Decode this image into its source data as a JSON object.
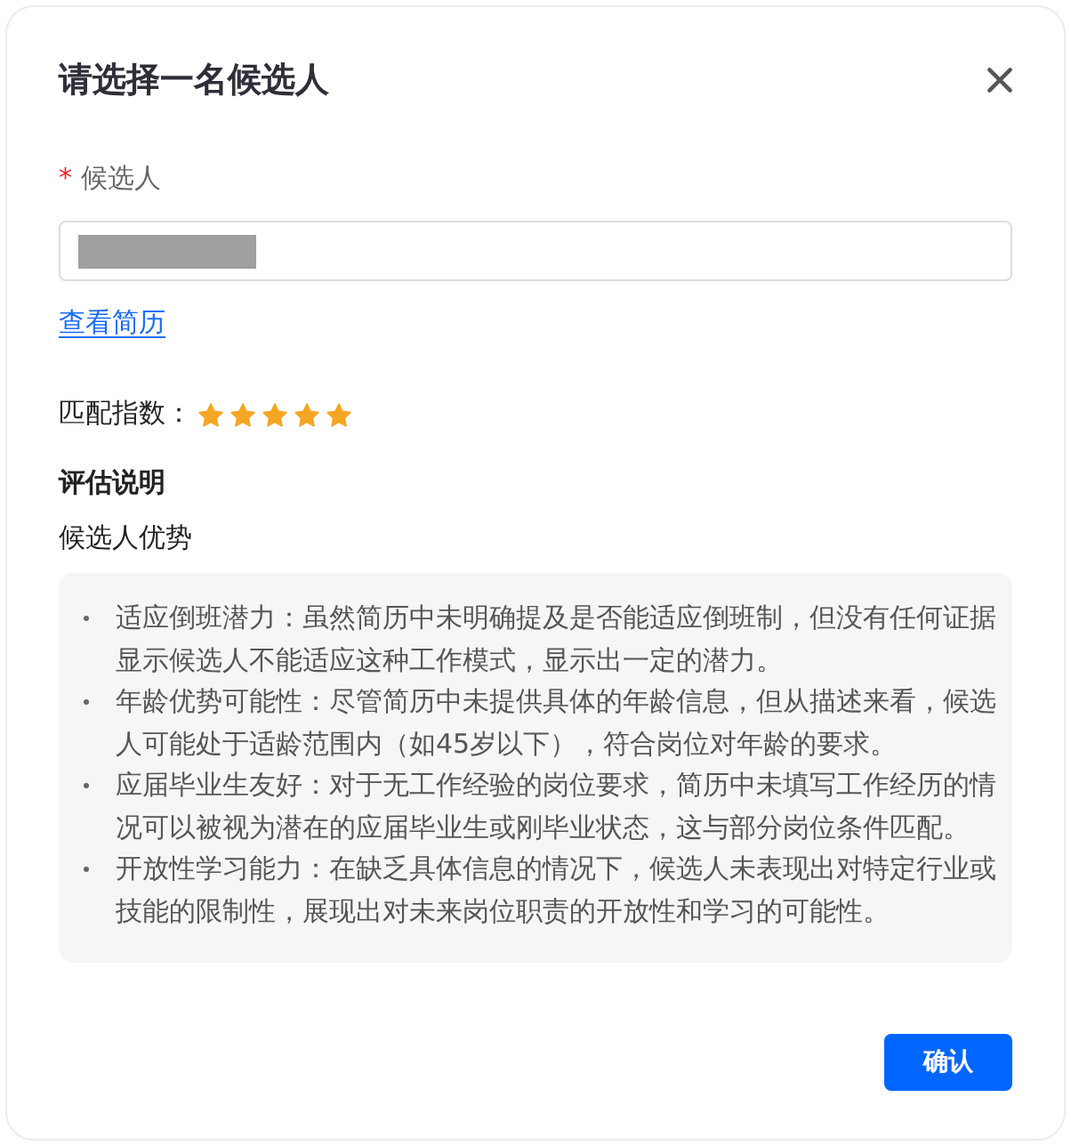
{
  "dialog": {
    "title": "请选择一名候选人"
  },
  "candidate_field": {
    "required_mark": "*",
    "label": "候选人",
    "value_redacted": true
  },
  "resume_link": {
    "label": "查看简历"
  },
  "match": {
    "label": "匹配指数：",
    "stars": 5
  },
  "evaluation": {
    "heading": "评估说明",
    "subheading": "候选人优势",
    "items": [
      "适应倒班潜力：虽然简历中未明确提及是否能适应倒班制，但没有任何证据显示候选人不能适应这种工作模式，显示出一定的潜力。",
      "年龄优势可能性：尽管简历中未提供具体的年龄信息，但从描述来看，候选人可能处于适龄范围内（如45岁以下），符合岗位对年龄的要求。",
      "应届毕业生友好：对于无工作经验的岗位要求，简历中未填写工作经历的情况可以被视为潜在的应届毕业生或刚毕业状态，这与部分岗位条件匹配。",
      "开放性学习能力：在缺乏具体信息的情况下，候选人未表现出对特定行业或技能的限制性，展现出对未来岗位职责的开放性和学习的可能性。"
    ]
  },
  "buttons": [
    {
      "label": "确认",
      "kind": "primary"
    }
  ]
}
